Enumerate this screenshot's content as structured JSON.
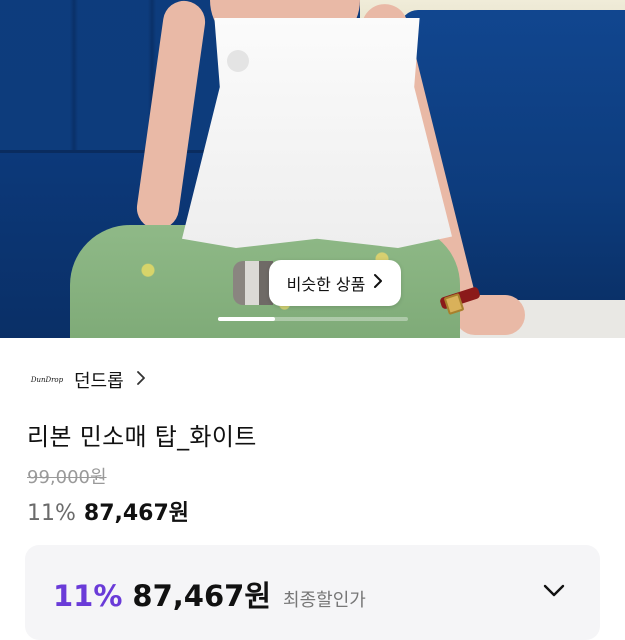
{
  "similar_products": {
    "label": "비슷한 상품"
  },
  "gallery": {
    "pager_progress": 0.3
  },
  "brand": {
    "logo_text": "DunDrop",
    "name": "던드롭"
  },
  "product": {
    "title": "리본 민소매 탑_화이트",
    "original_price": "99,000원",
    "discount_percent": "11%",
    "sale_price": "87,467원"
  },
  "final_discount": {
    "percent": "11%",
    "price": "87,467원",
    "label": "최종할인가"
  },
  "colors": {
    "accent": "#6a3bd8"
  },
  "icons": [
    "chevron-right-icon",
    "chevron-down-icon"
  ]
}
